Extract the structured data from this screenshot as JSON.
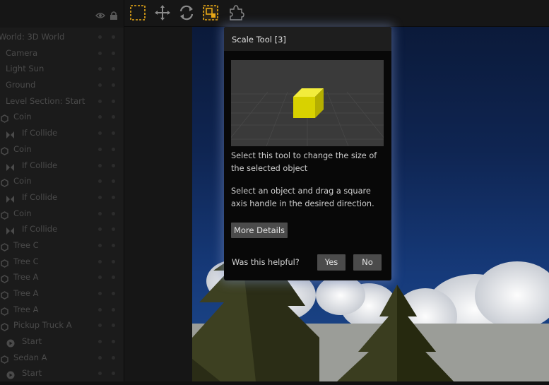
{
  "outline": {
    "items": [
      {
        "label": "World: 3D World",
        "icon": "none"
      },
      {
        "label": "Camera",
        "icon": "none"
      },
      {
        "label": "Light Sun",
        "icon": "none"
      },
      {
        "label": "Ground",
        "icon": "none"
      },
      {
        "label": "Level Section: Start",
        "icon": "none"
      },
      {
        "label": "Coin",
        "icon": "hexagon-icon"
      },
      {
        "label": "If Collide",
        "icon": "collide-icon"
      },
      {
        "label": "Coin",
        "icon": "hexagon-icon"
      },
      {
        "label": "If Collide",
        "icon": "collide-icon"
      },
      {
        "label": "Coin",
        "icon": "hexagon-icon"
      },
      {
        "label": "If Collide",
        "icon": "collide-icon"
      },
      {
        "label": "Coin",
        "icon": "hexagon-icon"
      },
      {
        "label": "If Collide",
        "icon": "collide-icon"
      },
      {
        "label": "Tree C",
        "icon": "hexagon-icon"
      },
      {
        "label": "Tree C",
        "icon": "hexagon-icon"
      },
      {
        "label": "Tree A",
        "icon": "hexagon-icon"
      },
      {
        "label": "Tree A",
        "icon": "hexagon-icon"
      },
      {
        "label": "Tree A",
        "icon": "hexagon-icon"
      },
      {
        "label": "Pickup Truck A",
        "icon": "hexagon-icon"
      },
      {
        "label": "Start",
        "icon": "play-icon"
      },
      {
        "label": "Sedan A",
        "icon": "hexagon-icon"
      },
      {
        "label": "Start",
        "icon": "play-icon"
      }
    ]
  },
  "toolbar": {
    "tools": [
      "select-tool-icon",
      "move-tool-icon",
      "rotate-tool-icon",
      "scale-tool-icon",
      "puzzle-tool-icon"
    ],
    "active": "scale-tool-icon"
  },
  "popup": {
    "title": "Scale Tool [3]",
    "desc1": "Select this tool to change the size of the selected object",
    "desc2": "Select an object and drag a square axis handle in the desired direction.",
    "more_details": "More Details",
    "question": "Was this helpful?",
    "yes": "Yes",
    "no": "No"
  },
  "colors": {
    "accent": "#e8a817",
    "cube": "#d8d200"
  }
}
